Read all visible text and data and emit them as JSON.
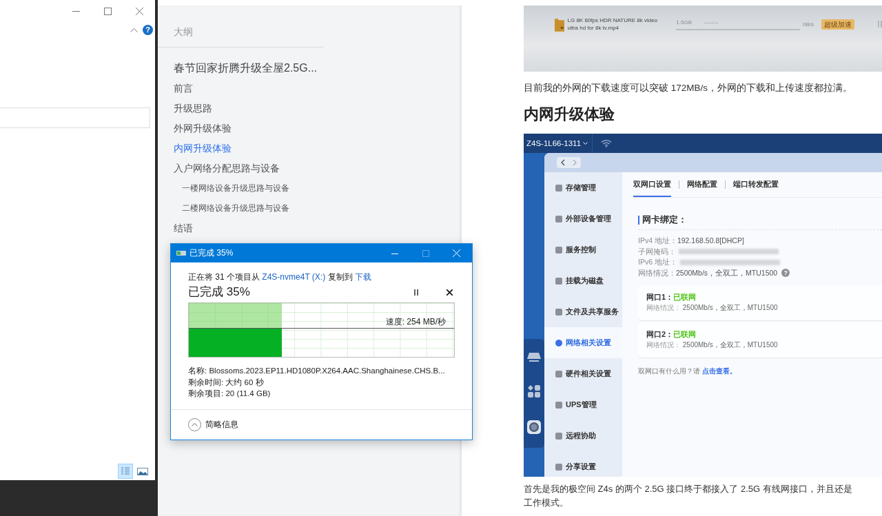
{
  "explorer": {
    "help_button": "?",
    "view_buttons": [
      {
        "kind": "details",
        "selected": true
      },
      {
        "kind": "preview",
        "selected": false
      }
    ]
  },
  "outline": {
    "title": "大纲",
    "document_title": "春节回家折腾升级全屋2.5G...",
    "items": [
      {
        "label": "前言",
        "selected": false
      },
      {
        "label": "升级思路",
        "selected": false
      },
      {
        "label": "外网升级体验",
        "selected": false
      },
      {
        "label": "内网升级体验",
        "selected": true
      },
      {
        "label": "入户网络分配思路与设备",
        "selected": false,
        "children": [
          {
            "label": "一楼网络设备升级思路与设备",
            "selected": false
          },
          {
            "label": "二楼网络设备升级思路与设备",
            "selected": false
          }
        ]
      },
      {
        "label": "结语",
        "selected": false
      }
    ]
  },
  "article": {
    "download_screenshot": {
      "file_name": "LG 8K 60fps HDR NATURE 8k video ultra hd for 8k tv.mp4",
      "size": "1.5GB",
      "time_left": "--:--:--",
      "speed": "0B/s",
      "boost_button": "超级加速"
    },
    "paragraph_1": "目前我的外网的下载速度可以突破 172MB/s，外网的下载和上传速度都拉满。",
    "heading": "内网升级体验",
    "nas_screenshot": {
      "device_name": "Z4S-1L66-1311",
      "sidebar": [
        {
          "label": "存储管理",
          "selected": false
        },
        {
          "label": "外部设备管理",
          "selected": false
        },
        {
          "label": "服务控制",
          "selected": false
        },
        {
          "label": "挂载为磁盘",
          "selected": false
        },
        {
          "label": "文件及共享服务",
          "selected": false
        },
        {
          "label": "网络相关设置",
          "selected": true
        },
        {
          "label": "硬件相关设置",
          "selected": false
        },
        {
          "label": "UPS管理",
          "selected": false
        },
        {
          "label": "远程协助",
          "selected": false
        },
        {
          "label": "分享设置",
          "selected": false
        }
      ],
      "tabs": [
        {
          "label": "双网口设置",
          "selected": true
        },
        {
          "label": "网络配置",
          "selected": false
        },
        {
          "label": "端口转发配置",
          "selected": false
        }
      ],
      "section_title": "网卡绑定：",
      "info": [
        {
          "kind": "text",
          "label": "IPv4 地址：",
          "value": "192.168.50.8[DHCP]"
        },
        {
          "kind": "blurred",
          "label": "子网掩码："
        },
        {
          "kind": "blurred",
          "label": "IPv6 地址："
        },
        {
          "kind": "help",
          "label": "网络情况：",
          "value": "2500Mb/s，全双工，MTU1500",
          "help_mark": "?"
        }
      ],
      "ports": [
        {
          "name": "网口1：",
          "status": "已联网",
          "detail_label": "网络情况：",
          "detail_value": "2500Mb/s，全双工，MTU1500"
        },
        {
          "name": "网口2：",
          "status": "已联网",
          "detail_label": "网络情况：",
          "detail_value": "2500Mb/s，全双工，MTU1500"
        }
      ],
      "help_text": "双网口有什么用？请 ",
      "help_link": "点击查看。"
    },
    "paragraph_2_lines": [
      "首先是我的极空间 Z4s 的两个 2.5G 接口终于都接入了 2.5G 有线网接口，并且还是",
      "工作模式。"
    ]
  },
  "copy_dialog": {
    "title": "已完成 35%",
    "message": {
      "prefix": "正在将 31 个项目从 ",
      "source": "Z4S-nvme4T (X:)",
      "middle": " 复制到 ",
      "destination": "下载"
    },
    "heading": "已完成 35%",
    "level": 0.35,
    "speed": "速度: 254 MB/秒",
    "details": [
      {
        "label": "名称:",
        "value": "Blossoms.2023.EP11.HD1080P.X264.AAC.Shanghainese.CHS.B..."
      },
      {
        "label": "剩余时间:",
        "value": "大约 60 秒"
      },
      {
        "label": "剩余项目:",
        "value": "20 (11.4 GB)"
      }
    ],
    "toggle": "简略信息"
  }
}
